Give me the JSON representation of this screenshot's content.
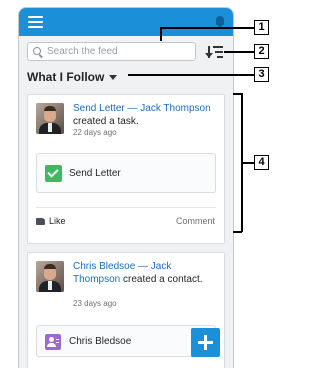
{
  "search": {
    "placeholder": "Search the feed"
  },
  "feed_filter": {
    "label": "What I Follow"
  },
  "posts": [
    {
      "author": "Send Letter — Jack Thompson",
      "action": "created a task.",
      "time": "22 days ago",
      "record": {
        "label": "Send Letter",
        "icon": "task-check-icon"
      },
      "like_label": "Like",
      "comment_label": "Comment"
    },
    {
      "author": "Chris Bledsoe — Jack Thompson",
      "action": "created a contact.",
      "time": "23 days ago",
      "record": {
        "label": "Chris Bledsoe",
        "icon": "contact-card-icon"
      }
    }
  ],
  "callouts": [
    "1",
    "2",
    "3",
    "4"
  ],
  "colors": {
    "header": "#1b8fd8",
    "link": "#1b6fc2",
    "task_icon": "#3dba5f",
    "contact_icon": "#9e6ad2"
  }
}
